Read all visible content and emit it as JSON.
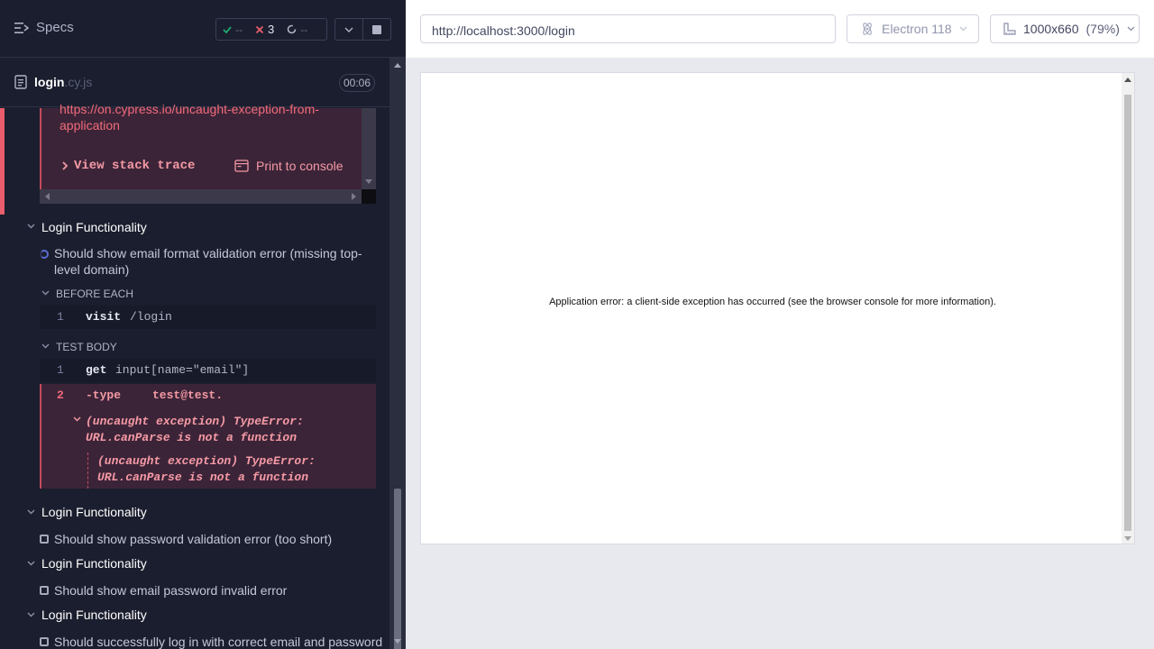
{
  "header": {
    "specs_label": "Specs",
    "stats": {
      "passed": "--",
      "failed": "3",
      "pending": "--"
    }
  },
  "spec": {
    "name": "login",
    "ext": ".cy.js",
    "duration": "00:06"
  },
  "error_top": {
    "link_text": "https://on.cypress.io/uncaught-exception-from-application",
    "view_stack_trace": "View stack trace",
    "print_to_console": "Print to console"
  },
  "tests": [
    {
      "suite": "Login Functionality",
      "title": "Should show email format validation error (missing top-level domain)",
      "before_each_label": "BEFORE EACH",
      "before_each_cmds": [
        {
          "num": "1",
          "name": "visit",
          "arg": "/login"
        }
      ],
      "test_body_label": "TEST BODY",
      "test_body_cmds": [
        {
          "num": "1",
          "name": "get",
          "arg": "input[name=\"email\"]"
        }
      ],
      "failed_cmd": {
        "num": "2",
        "name": "-type",
        "arg": "test@test.",
        "error": "(uncaught exception)  TypeError: URL.canParse is not a function",
        "error_nested": "(uncaught exception)  TypeError: URL.canParse is not a function"
      }
    },
    {
      "suite": "Login Functionality",
      "title": "Should show password validation error (too short)"
    },
    {
      "suite": "Login Functionality",
      "title": "Should show email password invalid error"
    },
    {
      "suite": "Login Functionality",
      "title": "Should successfully log in with correct email and password"
    }
  ],
  "aut": {
    "url": "http://localhost:3000/login",
    "browser": "Electron 118",
    "viewport": "1000x660",
    "scale": "(79%)",
    "app_error": "Application error: a client-side exception has occurred (see the browser console for more information)."
  },
  "colors": {
    "pass": "#1fa971",
    "fail": "#ea5d6d",
    "accent": "#5b6cd0"
  }
}
